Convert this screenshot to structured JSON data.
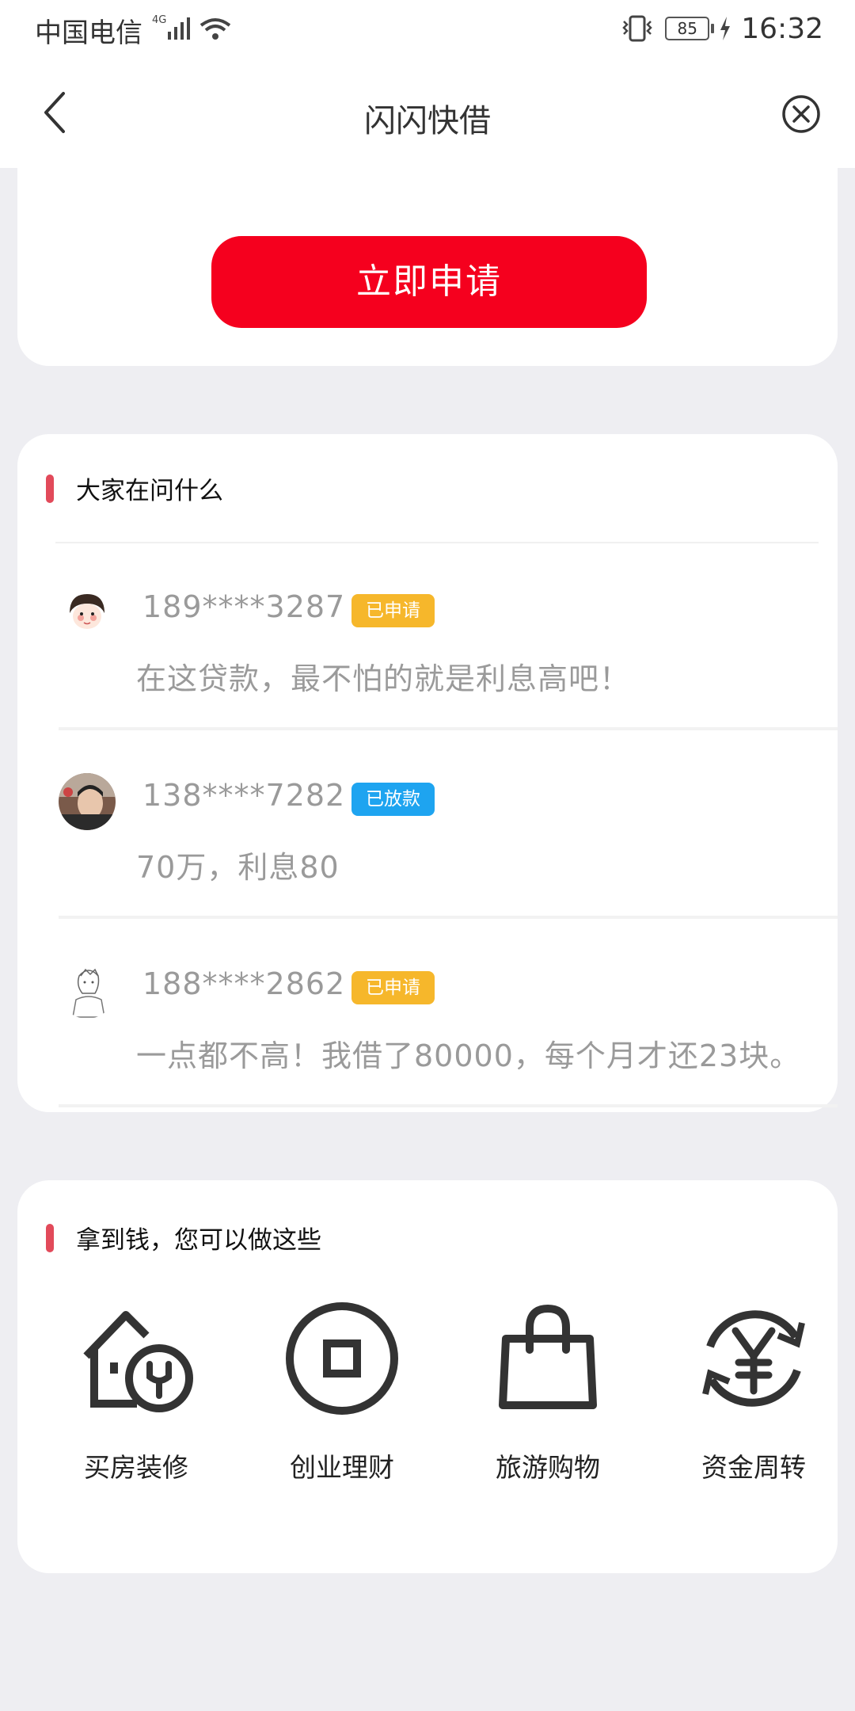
{
  "status_bar": {
    "carrier": "中国电信",
    "network": "4G",
    "battery": "85",
    "time": "16:32"
  },
  "nav": {
    "title": "闪闪快借"
  },
  "apply": {
    "button_label": "立即申请"
  },
  "qa_section": {
    "title": "大家在问什么",
    "items": [
      {
        "phone": "189****3287",
        "status": "已申请",
        "status_color": "#f6b72b",
        "message": "在这贷款，最不怕的就是利息高吧！"
      },
      {
        "phone": "138****7282",
        "status": "已放款",
        "status_color": "#1ea4f0",
        "message": "70万，利息80"
      },
      {
        "phone": "188****2862",
        "status": "已申请",
        "status_color": "#f6b72b",
        "message": "一点都不高！我借了80000，每个月才还23块。"
      }
    ]
  },
  "uses_section": {
    "title": "拿到钱，您可以做这些",
    "items": [
      {
        "label": "买房装修",
        "icon": "house-wrench-icon"
      },
      {
        "label": "创业理财",
        "icon": "coin-square-icon"
      },
      {
        "label": "旅游购物",
        "icon": "shopping-bag-icon"
      },
      {
        "label": "资金周转",
        "icon": "yuan-cycle-icon"
      }
    ]
  },
  "colors": {
    "accent": "#f5001e",
    "section_marker": "#e24a5a",
    "page_bg": "#eeeef2"
  }
}
